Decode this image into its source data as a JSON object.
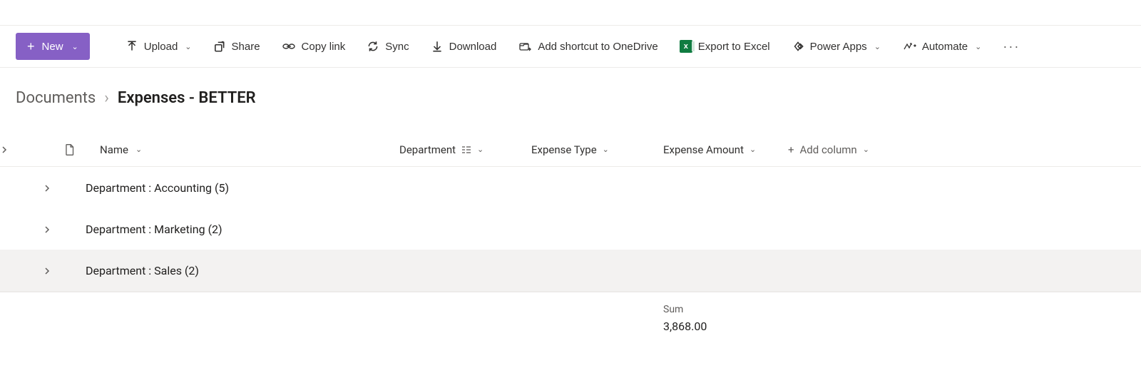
{
  "toolbar": {
    "new": {
      "label": "New"
    },
    "upload": {
      "label": "Upload"
    },
    "share": {
      "label": "Share"
    },
    "copylink": {
      "label": "Copy link"
    },
    "sync": {
      "label": "Sync"
    },
    "download": {
      "label": "Download"
    },
    "shortcut": {
      "label": "Add shortcut to OneDrive"
    },
    "excel": {
      "label": "Export to Excel"
    },
    "powerapps": {
      "label": "Power Apps"
    },
    "automate": {
      "label": "Automate"
    }
  },
  "breadcrumb": {
    "root": "Documents",
    "current": "Expenses - BETTER"
  },
  "columns": {
    "name": "Name",
    "department": "Department",
    "type": "Expense Type",
    "amount": "Expense Amount",
    "add": "Add column"
  },
  "groups": [
    {
      "label": "Department : Accounting (5)"
    },
    {
      "label": "Department : Marketing (2)"
    },
    {
      "label": "Department : Sales (2)"
    }
  ],
  "totals": {
    "label": "Sum",
    "value": "3,868.00"
  }
}
